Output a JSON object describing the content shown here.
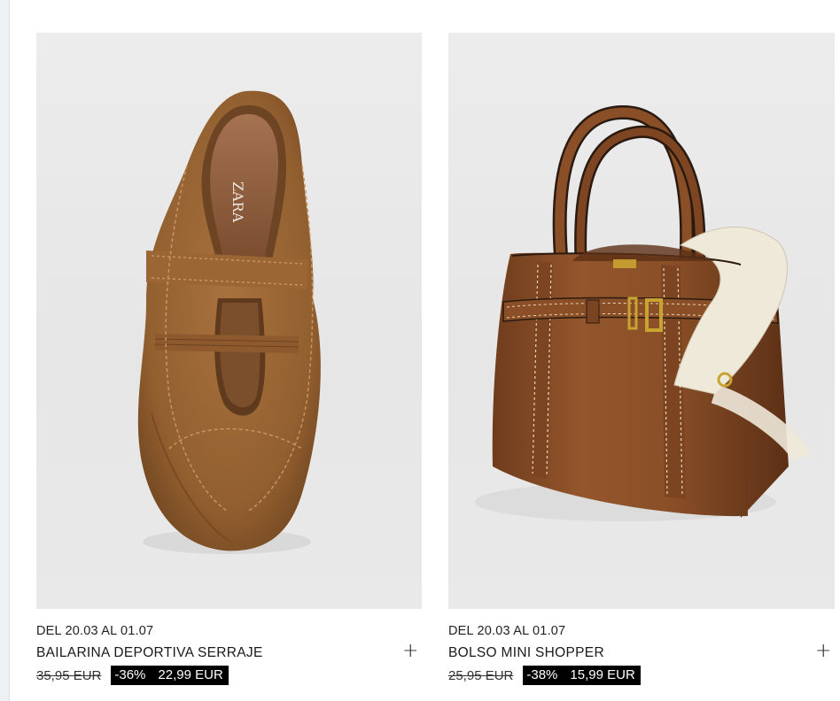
{
  "products": [
    {
      "image_alt": "BAILARINA DEPORTIVA SERRAJE",
      "insole_brand": "ZARA",
      "promo_dates": "DEL 20.03 AL 01.07",
      "name": "BAILARINA DEPORTIVA SERRAJE",
      "old_price": "35,95 EUR",
      "discount": "-36%",
      "new_price": "22,99 EUR",
      "add_label": "+"
    },
    {
      "image_alt": "BOLSO MINI SHOPPER",
      "promo_dates": "DEL 20.03 AL 01.07",
      "name": "BOLSO MINI SHOPPER",
      "old_price": "25,95 EUR",
      "discount": "-38%",
      "new_price": "15,99 EUR",
      "add_label": "+"
    }
  ],
  "colors": {
    "background": "#ffffff",
    "image_bg": "#e8e8e8",
    "suede": "#9a6634",
    "leather": "#8a4f28",
    "strap": "#efe9da",
    "price_block": "#000000"
  },
  "icons": {
    "add": "plus-icon"
  }
}
